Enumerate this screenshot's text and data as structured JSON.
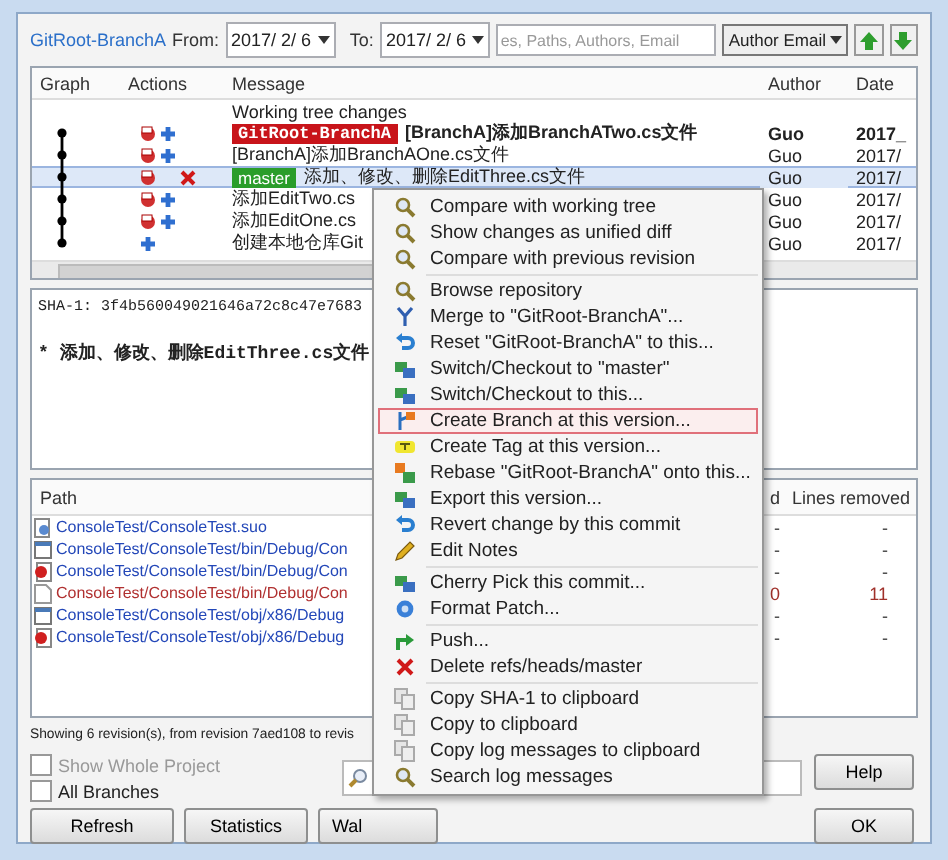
{
  "window": {
    "repo_link": "GitRoot-BranchA"
  },
  "filter": {
    "from_label": "From:",
    "from_date": "2017/ 2/ 6",
    "to_label": "To:",
    "to_date": "2017/ 2/ 6",
    "search_placeholder": "es, Paths, Authors, Email",
    "field_select": "Author Email"
  },
  "log": {
    "columns": [
      "Graph",
      "Actions",
      "Message",
      "Author",
      "Date"
    ],
    "rows": [
      {
        "kind": "working",
        "message": "Working tree changes",
        "selected": false
      },
      {
        "kind": "commit",
        "ref": {
          "text": "GitRoot-BranchA",
          "kind": "head"
        },
        "message": "[BranchA]添加BranchATwo.cs文件",
        "author": "Guo",
        "date": "2017_",
        "bold": true,
        "actions": [
          {
            "kind": "reset"
          },
          {
            "kind": "apply"
          }
        ],
        "selected": false
      },
      {
        "kind": "commit",
        "message": "[BranchA]添加BranchAOne.cs文件",
        "author": "Guo",
        "date": "2017/",
        "bold": false,
        "actions": [
          {
            "kind": "reset"
          },
          {
            "kind": "apply"
          }
        ],
        "selected": false
      },
      {
        "kind": "commit",
        "ref": {
          "text": "master",
          "kind": "branch"
        },
        "message": "添加、修改、删除EditThree.cs文件",
        "author": "Guo",
        "date": "2017/",
        "bold": false,
        "actions": [
          {
            "kind": "reset"
          },
          {
            "kind": "delete"
          }
        ],
        "selected": true
      },
      {
        "kind": "commit",
        "message": "添加EditTwo.cs",
        "author": "Guo",
        "date": "2017/",
        "bold": false,
        "actions": [
          {
            "kind": "reset"
          },
          {
            "kind": "apply"
          }
        ],
        "selected": false
      },
      {
        "kind": "commit",
        "message": "添加EditOne.cs",
        "author": "Guo",
        "date": "2017/",
        "bold": false,
        "actions": [
          {
            "kind": "reset"
          },
          {
            "kind": "apply"
          }
        ],
        "selected": false
      },
      {
        "kind": "commit",
        "message": "创建本地仓库Git",
        "author": "Guo",
        "date": "2017/",
        "bold": false,
        "actions": [
          {
            "kind": "apply"
          }
        ],
        "selected": false
      }
    ]
  },
  "details": {
    "sha": "SHA-1: 3f4b560049021646a72c8c47e7683",
    "message": "* 添加、修改、删除EditThree.cs文件"
  },
  "files": {
    "columns": [
      "Path",
      "d",
      "Lines removed"
    ],
    "rows": [
      {
        "kind": "settings",
        "path": "ConsoleTest/ConsoleTest.suo",
        "deleted": false,
        "added": "-",
        "removed": "-"
      },
      {
        "kind": "program",
        "path": "ConsoleTest/ConsoleTest/bin/Debug/Con",
        "deleted": false,
        "added": "-",
        "removed": "-"
      },
      {
        "kind": "debug",
        "path": "ConsoleTest/ConsoleTest/bin/Debug/Con",
        "deleted": false,
        "added": "-",
        "removed": "-"
      },
      {
        "kind": "plain",
        "path": "ConsoleTest/ConsoleTest/bin/Debug/Con",
        "deleted": true,
        "added": "0",
        "removed": "11"
      },
      {
        "kind": "program",
        "path": "ConsoleTest/ConsoleTest/obj/x86/Debug",
        "deleted": false,
        "added": "-",
        "removed": "-"
      },
      {
        "kind": "debug",
        "path": "ConsoleTest/ConsoleTest/obj/x86/Debug",
        "deleted": false,
        "added": "-",
        "removed": "-"
      }
    ]
  },
  "status": "Showing 6 revision(s), from revision 7aed108 to revis",
  "options": [
    {
      "label": "Show Whole Project",
      "checked": false,
      "disabled": true
    },
    {
      "label": "All Branches",
      "checked": false,
      "disabled": false
    }
  ],
  "buttons": [
    "Refresh",
    "Statistics",
    "Wal"
  ],
  "side_buttons": [
    "Help",
    "OK"
  ],
  "menu": [
    {
      "items": [
        {
          "kind": "magnifier",
          "label": "Compare with working tree",
          "selected": false
        },
        {
          "kind": "magnifier",
          "label": "Show changes as unified diff",
          "selected": false
        },
        {
          "kind": "magnifier",
          "label": "Compare with previous revision",
          "selected": false
        }
      ]
    },
    {
      "items": [
        {
          "kind": "magnifier",
          "label": "Browse repository",
          "selected": false
        },
        {
          "kind": "merge",
          "label": "Merge to \"GitRoot-BranchA\"...",
          "selected": false
        },
        {
          "kind": "undo",
          "label": "Reset \"GitRoot-BranchA\" to this...",
          "selected": false
        },
        {
          "kind": "boxes",
          "label": "Switch/Checkout to \"master\"",
          "selected": false
        },
        {
          "kind": "boxes",
          "label": "Switch/Checkout to this...",
          "selected": false
        },
        {
          "kind": "branch",
          "label": "Create Branch at this version...",
          "selected": true
        },
        {
          "kind": "tag",
          "label": "Create Tag at this version...",
          "selected": false
        },
        {
          "kind": "rebase",
          "label": "Rebase \"GitRoot-BranchA\" onto this...",
          "selected": false
        },
        {
          "kind": "boxes",
          "label": "Export this version...",
          "selected": false
        },
        {
          "kind": "undo",
          "label": "Revert change by this commit",
          "selected": false
        },
        {
          "kind": "pencil",
          "label": "Edit Notes",
          "selected": false
        }
      ]
    },
    {
      "items": [
        {
          "kind": "boxes",
          "label": "Cherry Pick this commit...",
          "selected": false
        },
        {
          "kind": "gear",
          "label": "Format Patch...",
          "selected": false
        }
      ]
    },
    {
      "items": [
        {
          "kind": "push",
          "label": "Push...",
          "selected": false
        },
        {
          "kind": "delete",
          "label": "Delete refs/heads/master",
          "selected": false
        }
      ]
    },
    {
      "items": [
        {
          "kind": "copy",
          "label": "Copy SHA-1 to clipboard",
          "selected": false
        },
        {
          "kind": "copy",
          "label": "Copy to clipboard",
          "selected": false
        },
        {
          "kind": "copy",
          "label": "Copy log messages to clipboard",
          "selected": false
        },
        {
          "kind": "magnifier",
          "label": "Search log messages",
          "selected": false
        }
      ]
    }
  ]
}
